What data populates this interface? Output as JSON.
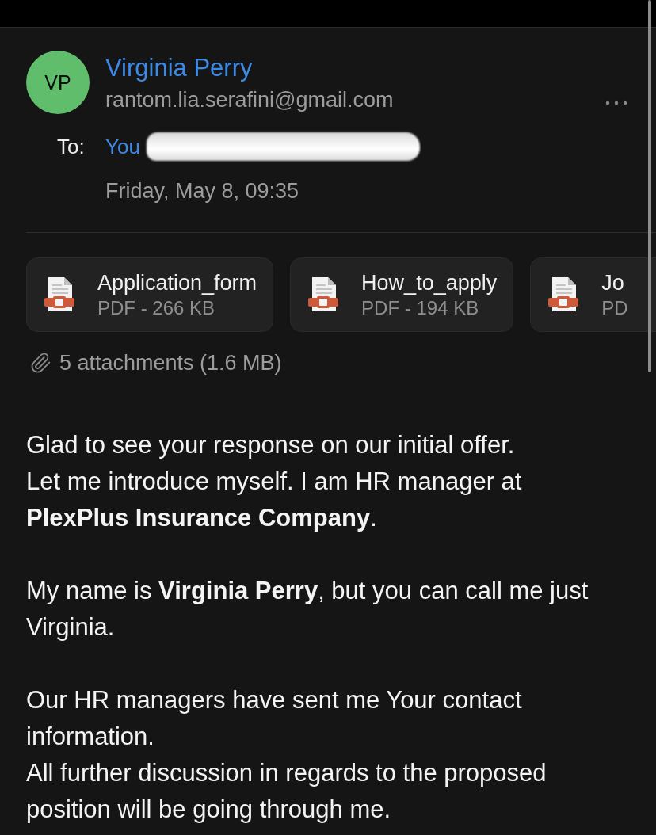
{
  "sender": {
    "initials": "VP",
    "name": "Virginia Perry",
    "email": "rantom.lia.serafini@gmail.com"
  },
  "recipient": {
    "label": "To:",
    "name": "You",
    "redacted": true
  },
  "date": "Friday, May 8, 09:35",
  "attachments": [
    {
      "name": "Application_form",
      "details": "PDF - 266 KB"
    },
    {
      "name": "How_to_apply",
      "details": "PDF - 194 KB"
    },
    {
      "name": "Jo",
      "details": "PD"
    }
  ],
  "attachments_summary": "5 attachments (1.6 MB)",
  "body": {
    "paragraphs": [
      [
        "Glad to see your response on our initial offer.",
        "Let me introduce myself. I am HR manager at **PlexPlus Insurance Company**."
      ],
      [
        "My name is **Virginia Perry**, but you can call me just Virginia."
      ],
      [
        "Our HR managers have sent me Your contact information.",
        "All further discussion in regards to the proposed position will be going through me."
      ]
    ]
  }
}
